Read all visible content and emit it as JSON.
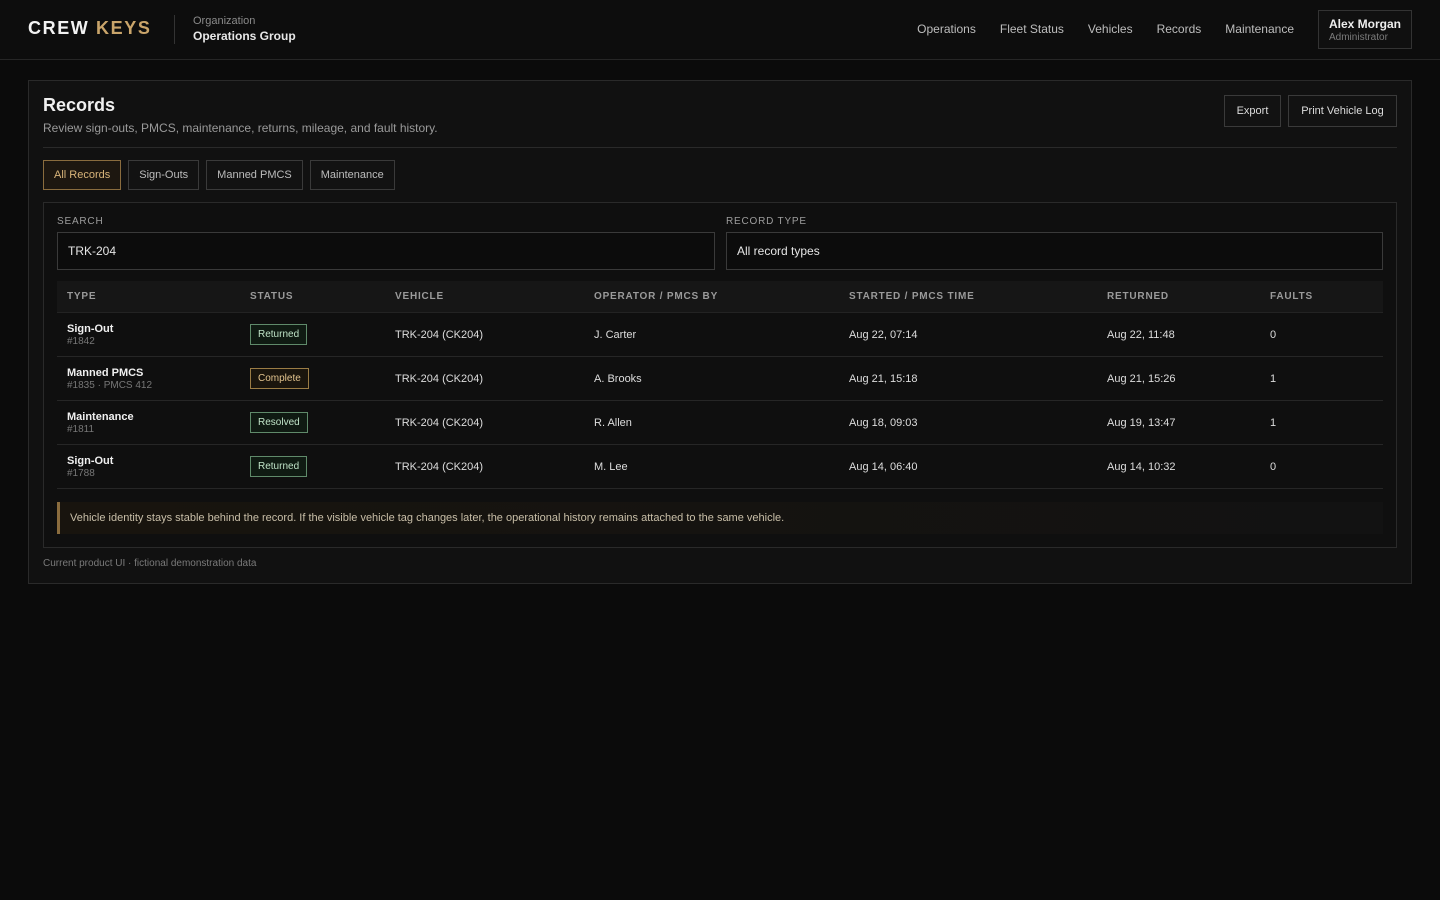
{
  "brand": {
    "word1": "CREW",
    "word2": "KEYS"
  },
  "org": {
    "label": "Organization",
    "name": "Operations Group"
  },
  "nav": [
    "Operations",
    "Fleet Status",
    "Vehicles",
    "Records",
    "Maintenance"
  ],
  "user": {
    "name": "Alex Morgan",
    "role": "Administrator"
  },
  "page": {
    "title": "Records",
    "subtitle": "Review sign-outs, PMCS, maintenance, returns, mileage, and fault history.",
    "export_label": "Export",
    "print_label": "Print Vehicle Log"
  },
  "tabs": [
    {
      "label": "All Records",
      "active": true
    },
    {
      "label": "Sign-Outs",
      "active": false
    },
    {
      "label": "Manned PMCS",
      "active": false
    },
    {
      "label": "Maintenance",
      "active": false
    }
  ],
  "filters": {
    "search_label": "Search",
    "search_value": "TRK-204",
    "type_label": "Record Type",
    "type_value": "All record types"
  },
  "table": {
    "headers": [
      "Type",
      "Status",
      "Vehicle",
      "Operator / PMCS by",
      "Started / PMCS time",
      "Returned",
      "Faults"
    ],
    "rows": [
      {
        "type": "Sign-Out",
        "id": "#1842",
        "status": "Returned",
        "status_tone": "green",
        "vehicle": "TRK-204 (CK204)",
        "operator": "J. Carter",
        "started": "Aug 22, 07:14",
        "returned": "Aug 22, 11:48",
        "faults": "0"
      },
      {
        "type": "Manned PMCS",
        "id": "#1835 · PMCS 412",
        "status": "Complete",
        "status_tone": "amber",
        "vehicle": "TRK-204 (CK204)",
        "operator": "A. Brooks",
        "started": "Aug 21, 15:18",
        "returned": "Aug 21, 15:26",
        "faults": "1"
      },
      {
        "type": "Maintenance",
        "id": "#1811",
        "status": "Resolved",
        "status_tone": "green",
        "vehicle": "TRK-204 (CK204)",
        "operator": "R. Allen",
        "started": "Aug 18, 09:03",
        "returned": "Aug 19, 13:47",
        "faults": "1"
      },
      {
        "type": "Sign-Out",
        "id": "#1788",
        "status": "Returned",
        "status_tone": "green",
        "vehicle": "TRK-204 (CK204)",
        "operator": "M. Lee",
        "started": "Aug 14, 06:40",
        "returned": "Aug 14, 10:32",
        "faults": "0"
      }
    ]
  },
  "notice": "Vehicle identity stays stable behind the record. If the visible vehicle tag changes later, the operational history remains attached to the same vehicle.",
  "footnote": "Current product UI · fictional demonstration data",
  "colors": {
    "accent": "#c9a46a",
    "background": "#0b0b0b",
    "panel": "#111111",
    "status_green": "#5f8a6a",
    "status_amber": "#9a7c45"
  }
}
